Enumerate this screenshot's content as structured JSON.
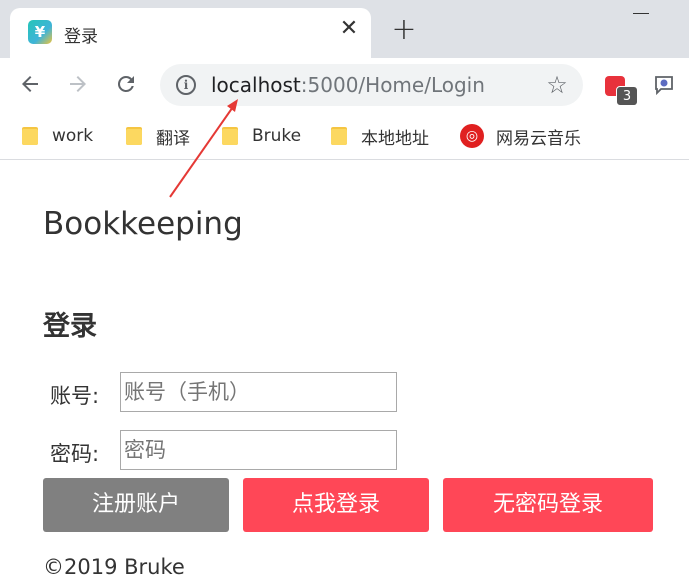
{
  "browser": {
    "tab": {
      "title": "登录",
      "favicon": "¥"
    },
    "address_bar": {
      "host": "localhost",
      "path": ":5000/Home/Login"
    },
    "extension_badge": "3",
    "bookmarks": [
      {
        "label": "work",
        "icon": "folder-icon"
      },
      {
        "label": "翻译",
        "icon": "folder-icon"
      },
      {
        "label": "Bruke",
        "icon": "folder-icon"
      },
      {
        "label": "本地地址",
        "icon": "folder-icon"
      },
      {
        "label": "网易云音乐",
        "icon": "netease-music-icon"
      }
    ]
  },
  "page": {
    "brand": "Bookkeeping",
    "heading": "登录",
    "account": {
      "label": "账号:",
      "placeholder": "账号（手机）"
    },
    "password": {
      "label": "密码:",
      "placeholder": "密码"
    },
    "buttons": {
      "register": "注册账户",
      "login": "点我登录",
      "passwordless": "无密码登录"
    },
    "footer": "©2019 Bruke"
  },
  "colors": {
    "primary_red": "#ff4757",
    "secondary_gray": "#808080",
    "annotation_arrow": "#e53935"
  }
}
